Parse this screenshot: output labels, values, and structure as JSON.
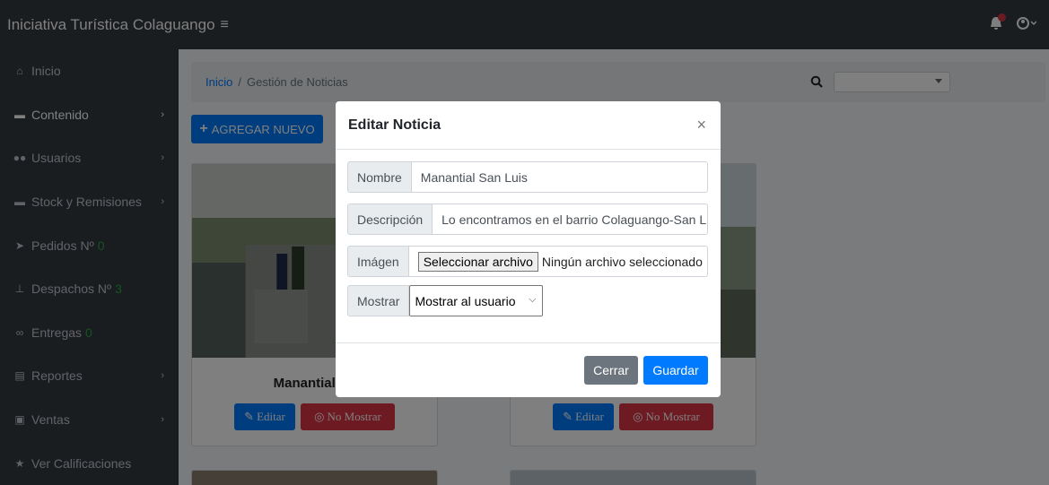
{
  "app": {
    "title": "Iniciativa Turística Colaguango",
    "menu_icon": "≡"
  },
  "topbar": {
    "notification_icon": "bell-icon",
    "user_icon": "user-circle-icon"
  },
  "sidebar": {
    "items": [
      {
        "label": "Inicio",
        "icon": "home-icon",
        "has_chevron": false
      },
      {
        "label": "Contenido",
        "icon": "folder-icon",
        "has_chevron": true
      },
      {
        "label": "Usuarios",
        "icon": "users-icon",
        "has_chevron": true
      },
      {
        "label": "Stock y Remisiones",
        "icon": "folder-icon",
        "has_chevron": true
      },
      {
        "label": "Pedidos Nº",
        "count": "0",
        "icon": "send-icon",
        "has_chevron": false
      },
      {
        "label": "Despachos Nº",
        "count": "3",
        "icon": "dolly-icon",
        "has_chevron": false
      },
      {
        "label": "Entregas",
        "count": "0",
        "icon": "bicycle-icon",
        "has_chevron": false
      },
      {
        "label": "Reportes",
        "icon": "table-icon",
        "has_chevron": true
      },
      {
        "label": "Ventas",
        "icon": "cash-register-icon",
        "has_chevron": true
      },
      {
        "label": "Ver Calificaciones",
        "icon": "star-icon",
        "has_chevron": false
      }
    ]
  },
  "breadcrumb": {
    "home": "Inicio",
    "separator": "/",
    "current": "Gestión de Noticias"
  },
  "search": {
    "icon": "search-icon",
    "selected": ""
  },
  "toolbar": {
    "add_label": "AGREGAR NUEVO",
    "add_icon": "+"
  },
  "cards": [
    {
      "title": "Manantial Sa",
      "edit_label": "Editar",
      "hide_label": "No Mostrar"
    },
    {
      "title": "",
      "edit_label": "Editar",
      "hide_label": "No Mostrar"
    }
  ],
  "modal": {
    "title": "Editar Noticia",
    "close_symbol": "×",
    "fields": {
      "nombre": {
        "label": "Nombre",
        "value": "Manantial San Luis"
      },
      "descripcion": {
        "label": "Descripción",
        "value": "Lo encontramos en el barrio Colaguango-San L"
      },
      "imagen": {
        "label": "Imágen",
        "button": "Seleccionar archivo",
        "status": "Ningún archivo seleccionado"
      },
      "mostrar": {
        "label": "Mostrar",
        "selected": "Mostrar al usuario"
      }
    },
    "footer": {
      "close_label": "Cerrar",
      "save_label": "Guardar"
    }
  },
  "colors": {
    "primary": "#007bff",
    "danger": "#dc3545",
    "secondary": "#6c757d",
    "sidebar": "#343a40",
    "success": "#28a745"
  }
}
